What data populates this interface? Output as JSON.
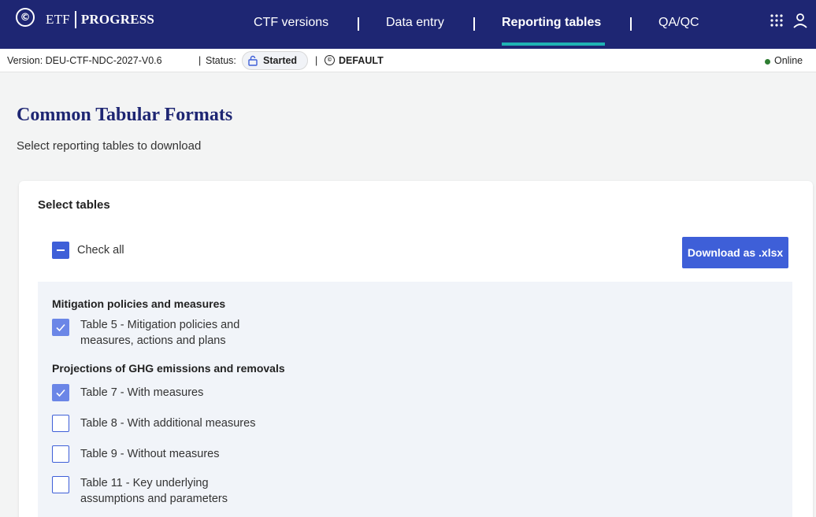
{
  "nav": {
    "brand_prefix": "ETF",
    "brand_name": "PROGRESS",
    "items": [
      {
        "label": "CTF versions",
        "active": false
      },
      {
        "label": "Data entry",
        "active": false
      },
      {
        "label": "Reporting tables",
        "active": true
      },
      {
        "label": "QA/QC",
        "active": false
      }
    ],
    "accent_color": "#1fb2b4",
    "bar_color": "#1e2673"
  },
  "status": {
    "version_text": "Version: DEU-CTF-NDC-2027-V0.6",
    "status_label": "Status:",
    "status_value": "Started",
    "workspace": "DEFAULT",
    "connection": "Online"
  },
  "page": {
    "title": "Common Tabular Formats",
    "subtitle": "Select reporting tables to download"
  },
  "card": {
    "title": "Select tables",
    "check_all_label": "Check all",
    "download_label": "Download as .xlsx",
    "groups": [
      {
        "heading": "Mitigation policies and measures",
        "tables": [
          {
            "label_line1": "Table 5 - Mitigation policies and",
            "label_line2": "measures, actions and plans",
            "checked": true
          }
        ]
      },
      {
        "heading": "Projections of GHG emissions and removals",
        "tables": [
          {
            "label_line1": "Table 7 - With measures",
            "checked": true
          },
          {
            "label_line1": "Table 8 - With additional measures",
            "checked": false
          },
          {
            "label_line1": "Table 9 - Without measures",
            "checked": false
          },
          {
            "label_line1": "Table 11 - Key underlying",
            "label_line2": "assumptions and parameters",
            "checked": false
          }
        ]
      }
    ]
  }
}
